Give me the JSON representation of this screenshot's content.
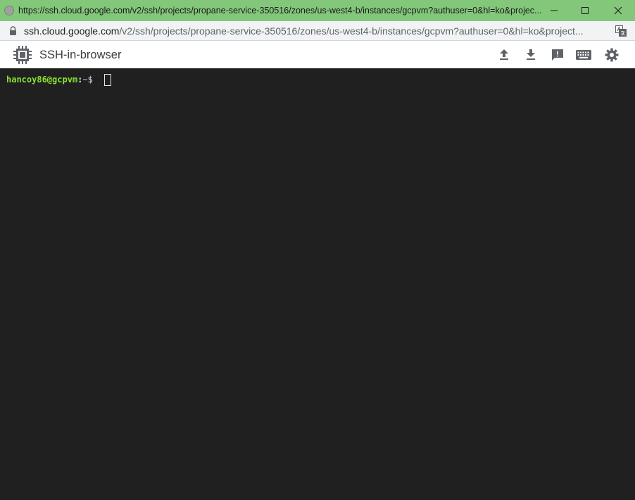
{
  "window": {
    "title": "https://ssh.cloud.google.com/v2/ssh/projects/propane-service-350516/zones/us-west4-b/instances/gcpvm?authuser=0&hl=ko&projec...",
    "controls": {
      "minimize": "minimize-icon",
      "maximize": "maximize-icon",
      "close": "close-icon"
    },
    "titlebar_color": "#83c77b"
  },
  "address_bar": {
    "host": "ssh.cloud.google.com",
    "path": "/v2/ssh/projects/propane-service-350516/zones/us-west4-b/instances/gcpvm?authuser=0&hl=ko&project..."
  },
  "app": {
    "title": "SSH-in-browser",
    "toolbar": [
      {
        "name": "upload-file",
        "icon": "upload-icon"
      },
      {
        "name": "download-file",
        "icon": "download-icon"
      },
      {
        "name": "send-feedback",
        "icon": "feedback-icon"
      },
      {
        "name": "keyboard",
        "icon": "keyboard-icon"
      },
      {
        "name": "settings",
        "icon": "gear-icon"
      }
    ]
  },
  "terminal": {
    "user_host": "hancoy86@gcpvm",
    "separator": ":",
    "path": "~",
    "prompt_symbol": "$ ",
    "background": "#202020"
  }
}
